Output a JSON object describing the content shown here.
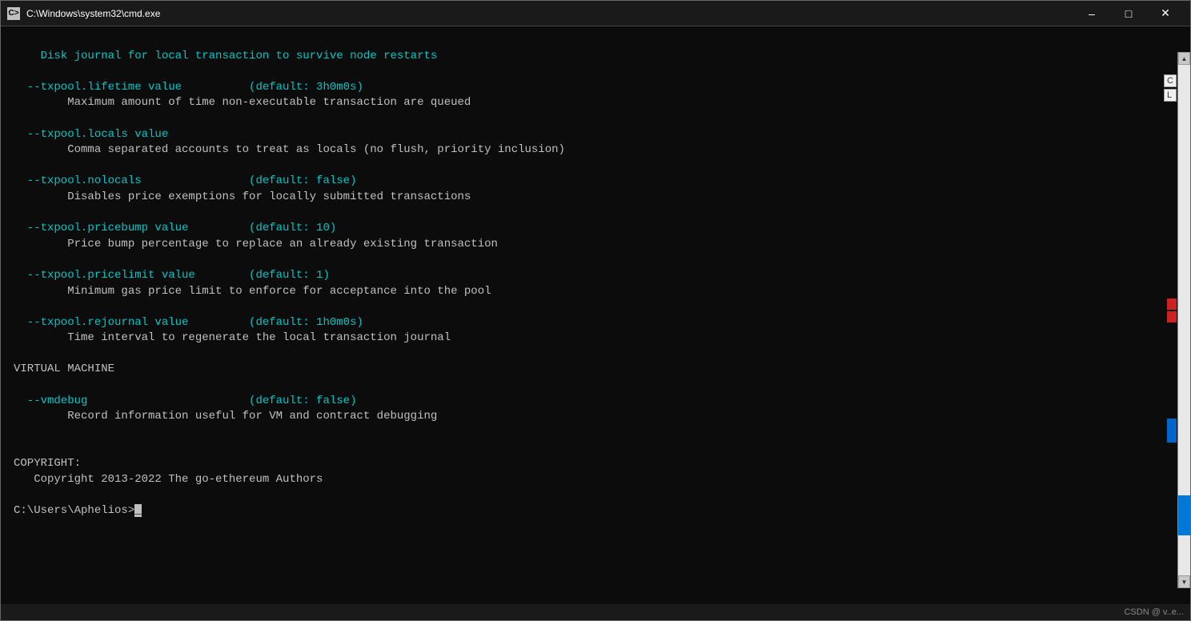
{
  "window": {
    "title": "C:\\Windows\\system32\\cmd.exe",
    "icon": "CMD"
  },
  "titlebar": {
    "minimize_label": "–",
    "maximize_label": "□",
    "close_label": "✕"
  },
  "terminal": {
    "lines": [
      "    Disk journal for local transaction to survive node restarts",
      "",
      "  --txpool.lifetime value          (default: 3h0m0s)",
      "        Maximum amount of time non-executable transaction are queued",
      "",
      "  --txpool.locals value",
      "        Comma separated accounts to treat as locals (no flush, priority inclusion)",
      "",
      "  --txpool.nolocals                (default: false)",
      "        Disables price exemptions for locally submitted transactions",
      "",
      "  --txpool.pricebump value         (default: 10)",
      "        Price bump percentage to replace an already existing transaction",
      "",
      "  --txpool.pricelimit value        (default: 1)",
      "        Minimum gas price limit to enforce for acceptance into the pool",
      "",
      "  --txpool.rejournal value         (default: 1h0m0s)",
      "        Time interval to regenerate the local transaction journal",
      "",
      "VIRTUAL MACHINE",
      "",
      "  --vmdebug                        (default: false)",
      "        Record information useful for VM and contract debugging",
      "",
      "",
      "COPYRIGHT:",
      "   Copyright 2013-2022 The go-ethereum Authors",
      "",
      "C:\\Users\\Aphelios>_"
    ]
  },
  "status_bar": {
    "text": "CSDN @ v..e..."
  },
  "sidebar": {
    "labels": [
      "C",
      "L"
    ],
    "red_items": 2,
    "blue_item": true
  }
}
